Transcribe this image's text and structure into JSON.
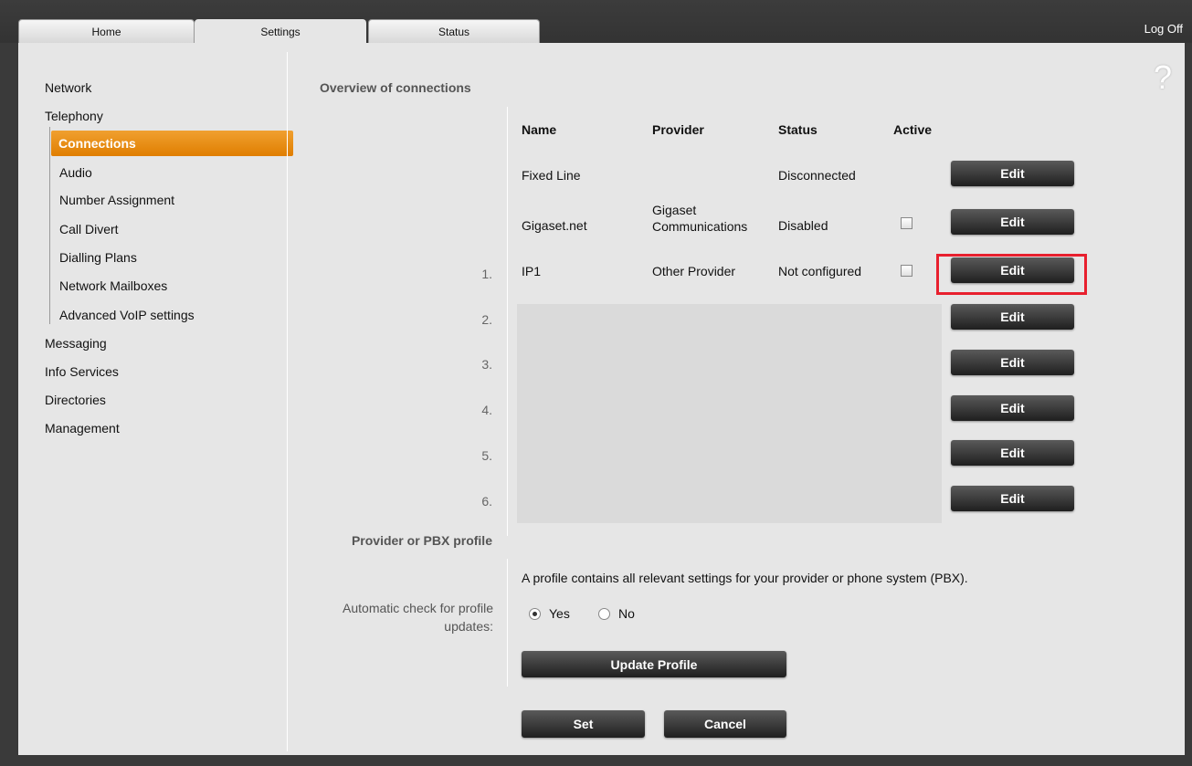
{
  "tabs": [
    "Home",
    "Settings",
    "Status"
  ],
  "logoff": "Log Off",
  "help_symbol": "?",
  "sidebar": {
    "items": [
      {
        "label": "Network"
      },
      {
        "label": "Telephony"
      },
      {
        "label": "Connections",
        "active": true
      },
      {
        "label": "Audio"
      },
      {
        "label": "Number Assignment"
      },
      {
        "label": "Call Divert"
      },
      {
        "label": "Dialling Plans"
      },
      {
        "label": "Network Mailboxes"
      },
      {
        "label": "Advanced VoIP settings"
      },
      {
        "label": "Messaging"
      },
      {
        "label": "Info Services"
      },
      {
        "label": "Directories"
      },
      {
        "label": "Management"
      }
    ]
  },
  "overview": {
    "title": "Overview of connections",
    "columns": [
      "Name",
      "Provider",
      "Status",
      "Active"
    ],
    "rows": [
      {
        "num": "",
        "name": "Fixed Line",
        "provider": "",
        "status": "Disconnected",
        "edit": "Edit"
      },
      {
        "num": "",
        "name": "Gigaset.net",
        "provider": "Gigaset Communications",
        "status": "Disabled",
        "edit": "Edit"
      },
      {
        "num": "1.",
        "name": "IP1",
        "provider": "Other Provider",
        "status": "Not configured",
        "edit": "Edit"
      },
      {
        "num": "2.",
        "edit": "Edit"
      },
      {
        "num": "3.",
        "edit": "Edit"
      },
      {
        "num": "4.",
        "edit": "Edit"
      },
      {
        "num": "5.",
        "edit": "Edit"
      },
      {
        "num": "6.",
        "edit": "Edit"
      }
    ]
  },
  "profile": {
    "title": "Provider or PBX profile",
    "description": "A profile contains all relevant settings for your provider or phone system (PBX).",
    "auto_check_label": "Automatic check for profile updates:",
    "yes": "Yes",
    "no": "No",
    "selected": "Yes",
    "update_button": "Update Profile"
  },
  "actions": {
    "set": "Set",
    "cancel": "Cancel"
  },
  "colors": {
    "accent": "#e8880d",
    "highlight": "#e8202e"
  }
}
